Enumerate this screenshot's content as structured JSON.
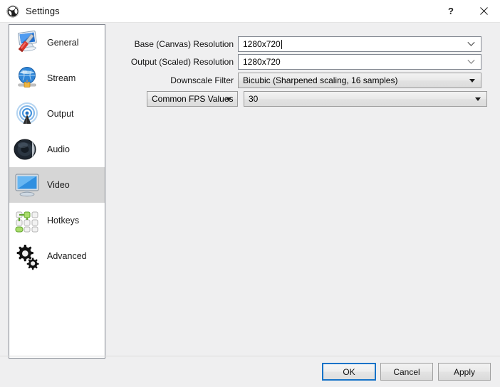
{
  "window": {
    "title": "Settings",
    "logo_icon": "obs-logo-icon",
    "help_label": "?",
    "close_label": "✕"
  },
  "sidebar": {
    "items": [
      {
        "label": "General",
        "icon": "monitor-screwdriver-icon",
        "selected": false
      },
      {
        "label": "Stream",
        "icon": "globe-antenna-icon",
        "selected": false
      },
      {
        "label": "Output",
        "icon": "broadcast-tower-icon",
        "selected": false
      },
      {
        "label": "Audio",
        "icon": "speaker-icon",
        "selected": false
      },
      {
        "label": "Video",
        "icon": "monitor-icon",
        "selected": true
      },
      {
        "label": "Hotkeys",
        "icon": "keyboard-keys-icon",
        "selected": false
      },
      {
        "label": "Advanced",
        "icon": "gears-icon",
        "selected": false
      }
    ]
  },
  "form": {
    "base_resolution": {
      "label": "Base (Canvas) Resolution",
      "value": "1280x720",
      "editable": true,
      "focused": true
    },
    "output_resolution": {
      "label": "Output (Scaled) Resolution",
      "value": "1280x720",
      "editable": true,
      "focused": false
    },
    "downscale_filter": {
      "label": "Downscale Filter",
      "value": "Bicubic (Sharpened scaling, 16 samples)"
    },
    "fps_type": {
      "value": "Common FPS Values"
    },
    "fps_value": {
      "value": "30"
    }
  },
  "footer": {
    "ok_label": "OK",
    "cancel_label": "Cancel",
    "apply_label": "Apply"
  },
  "colors": {
    "accent_focus": "#1673c8",
    "dialog_bg": "#efeff0",
    "selection_bg": "#d6d6d6",
    "border": "#828790"
  }
}
